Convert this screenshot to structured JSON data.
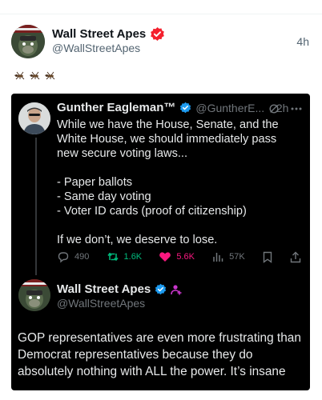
{
  "post": {
    "author_name": "Wall Street Apes",
    "author_handle": "@WallStreetApes",
    "time": "4h",
    "emoji_count": 3,
    "emoji_icon": "mosquito-icon",
    "badge_color": "#f4212e"
  },
  "quote_tweet": {
    "author_name": "Gunther Eagleman™",
    "author_handle": "@GuntherE...",
    "separator": "·",
    "time": "2h",
    "body": "While we have the House, Senate, and the White House, we should immediately pass new secure voting laws...\n\n- Paper ballots\n- Same day voting\n- Voter ID cards (proof of citizenship)\n\nIf we don’t, we deserve to lose.",
    "actions": {
      "replies": "490",
      "reposts": "1.6K",
      "likes": "5.6K",
      "views": "57K"
    },
    "verified_color": "#1d9bf0"
  },
  "reply": {
    "author_name": "Wall Street Apes",
    "author_handle": "@WallStreetApes",
    "body": "GOP representatives are even more frustrating than Democrat representatives because they do absolutely nothing with ALL the power. It’s insane",
    "verified_color": "#1d9bf0",
    "affiliate_color": "#c936cc"
  }
}
